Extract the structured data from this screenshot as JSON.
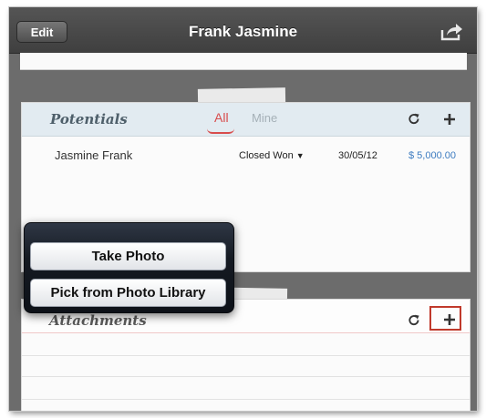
{
  "navbar": {
    "edit_label": "Edit",
    "title": "Frank Jasmine",
    "share_icon": "share-icon"
  },
  "potentials": {
    "title": "Potentials",
    "tabs": {
      "all": "All",
      "mine": "Mine"
    },
    "active_tab": "All",
    "accent_color": "#d84c4c",
    "rows": [
      {
        "name": "Jasmine Frank",
        "stage": "Closed Won",
        "date": "30/05/12",
        "amount": "$ 5,000.00"
      }
    ]
  },
  "attachments": {
    "title": "Attachments"
  },
  "popover": {
    "take_photo": "Take Photo",
    "pick_library": "Pick from Photo Library"
  },
  "colors": {
    "amount_link": "#3d7cc0",
    "highlight": "#c0392b"
  }
}
